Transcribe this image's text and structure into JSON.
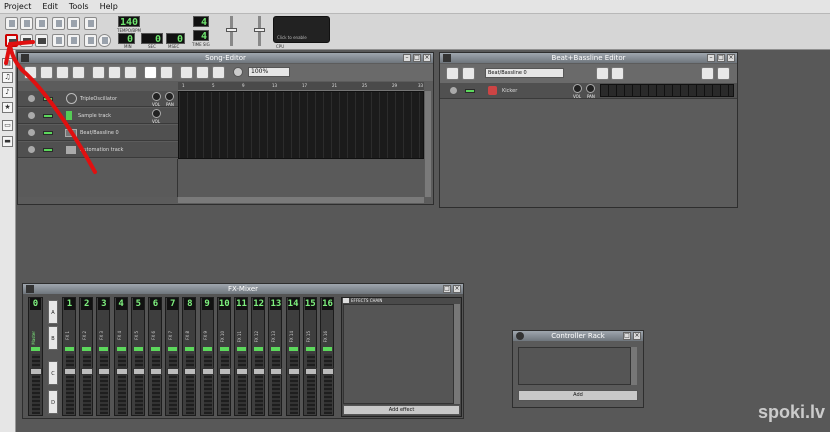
{
  "menu": {
    "project": "Project",
    "edit": "Edit",
    "tools": "Tools",
    "help": "Help"
  },
  "toolbar": {
    "tempo_value": "140",
    "tempo_label": "TEMPO/BPM",
    "time_min": "0",
    "time_sec": "0",
    "time_msec": "0",
    "min_label": "MIN",
    "sec_label": "SEC",
    "msec_label": "MSEC",
    "sig_num": "4",
    "sig_den": "4",
    "sig_label": "TIME SIG",
    "cpu_text": "Click to enable",
    "cpu_label": "CPU"
  },
  "song_editor": {
    "title": "Song-Editor",
    "zoom": "100%",
    "ruler": [
      "1",
      "5",
      "9",
      "13",
      "17",
      "21",
      "25",
      "29",
      "33"
    ],
    "tracks": [
      {
        "name": "TripleOscillator",
        "vol": "VOL",
        "pan": "PAN"
      },
      {
        "name": "Sample track",
        "vol": "VOL"
      },
      {
        "name": "Beat/Bassline 0"
      },
      {
        "name": "Automation track"
      }
    ]
  },
  "bb_editor": {
    "title": "Beat+Bassline Editor",
    "selector": "Beat/Bassline 0",
    "tracks": [
      {
        "name": "Kicker",
        "vol": "VOL",
        "pan": "PAN"
      }
    ]
  },
  "fx_mixer": {
    "title": "FX-Mixer",
    "master_label": "Master",
    "channels": [
      "1",
      "2",
      "3",
      "4",
      "5",
      "6",
      "7",
      "8",
      "9",
      "10",
      "11",
      "12",
      "13",
      "14",
      "15",
      "16"
    ],
    "channel_prefix": "FX ",
    "banks": [
      "A",
      "B",
      "C",
      "D"
    ],
    "effects_chain_label": "EFFECTS CHAIN",
    "add_effect": "Add effect"
  },
  "controller_rack": {
    "title": "Controller Rack",
    "add": "Add"
  },
  "watermark": "spoki.lv"
}
